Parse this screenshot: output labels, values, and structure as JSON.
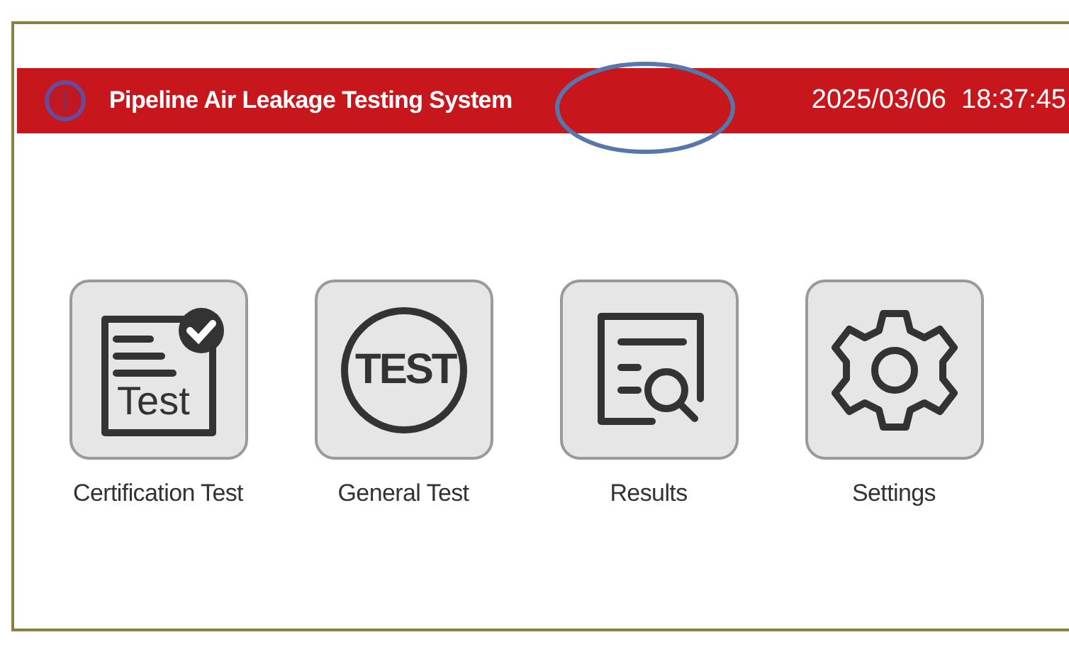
{
  "header": {
    "title": "Pipeline Air Leakage Testing System",
    "datetime": "2025/03/06  18:37:45"
  },
  "tiles": [
    {
      "label": "Certification Test",
      "kind": "certification",
      "icon_text": "Test"
    },
    {
      "label": "General Test",
      "kind": "general",
      "icon_text": "TEST"
    },
    {
      "label": "Results",
      "kind": "results"
    },
    {
      "label": "Settings",
      "kind": "settings"
    }
  ]
}
